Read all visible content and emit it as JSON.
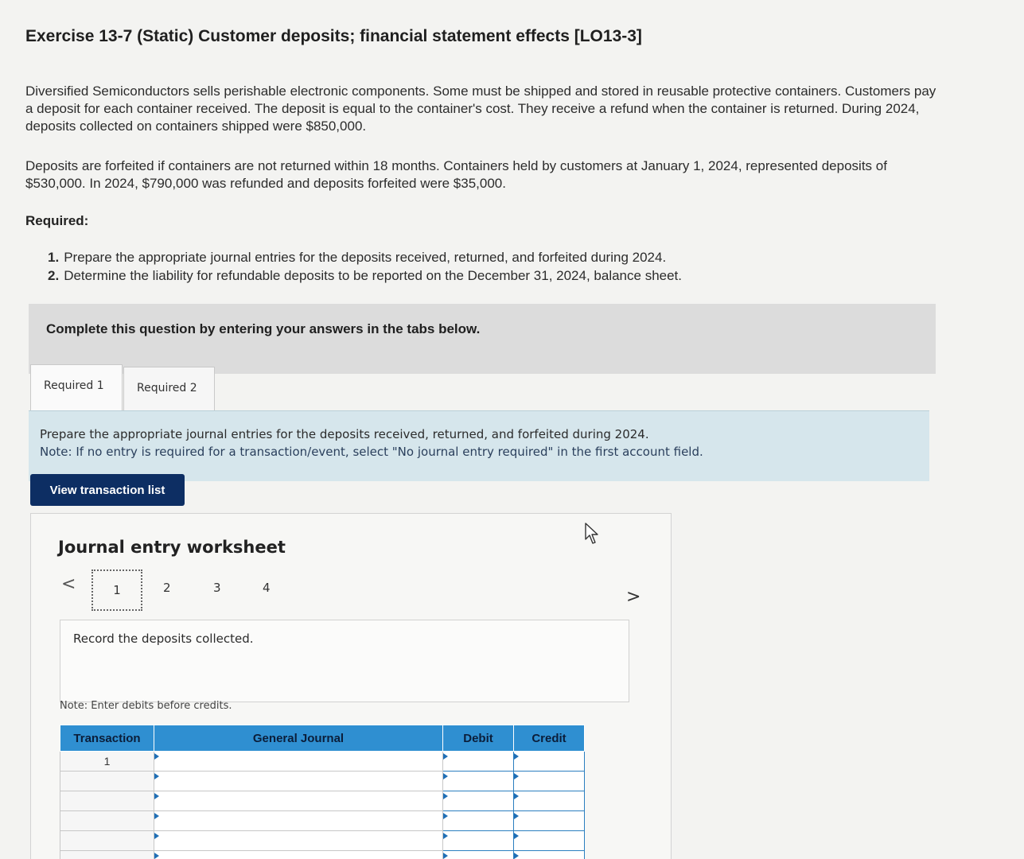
{
  "title": "Exercise 13-7 (Static) Customer deposits; financial statement effects [LO13-3]",
  "paragraph1": "Diversified Semiconductors sells perishable electronic components. Some must be shipped and stored in reusable protective containers. Customers pay a deposit for each container received. The deposit is equal to the container's cost. They receive a refund when the container is returned. During 2024, deposits collected on containers shipped were $850,000.",
  "paragraph2": "Deposits are forfeited if containers are not returned within 18 months. Containers held by customers at January 1, 2024, represented deposits of $530,000. In 2024, $790,000 was refunded and deposits forfeited were $35,000.",
  "required_label": "Required:",
  "requirements": [
    {
      "num": "1.",
      "text": "Prepare the appropriate journal entries for the deposits received, returned, and forfeited during 2024."
    },
    {
      "num": "2.",
      "text": "Determine the liability for refundable deposits to be reported on the December 31, 2024, balance sheet."
    }
  ],
  "complete_prompt": "Complete this question by entering your answers in the tabs below.",
  "tabs": [
    {
      "label": "Required 1"
    },
    {
      "label": "Required 2"
    }
  ],
  "instructions": {
    "main": "Prepare the appropriate journal entries for the deposits received, returned, and forfeited during 2024.",
    "note": "Note: If no entry is required for a transaction/event, select \"No journal entry required\" in the first account field."
  },
  "view_button": "View transaction list",
  "worksheet": {
    "title": "Journal entry worksheet",
    "steps": [
      "1",
      "2",
      "3",
      "4"
    ],
    "active_step": "1",
    "prev_icon": "<",
    "next_icon": ">",
    "record_text": "Record the deposits collected.",
    "enter_note": "Note: Enter debits before credits."
  },
  "table": {
    "headers": {
      "transaction": "Transaction",
      "general_journal": "General Journal",
      "debit": "Debit",
      "credit": "Credit"
    },
    "rows": [
      {
        "transaction": "1",
        "account": "",
        "debit": "",
        "credit": ""
      },
      {
        "transaction": "",
        "account": "",
        "debit": "",
        "credit": ""
      },
      {
        "transaction": "",
        "account": "",
        "debit": "",
        "credit": ""
      },
      {
        "transaction": "",
        "account": "",
        "debit": "",
        "credit": ""
      },
      {
        "transaction": "",
        "account": "",
        "debit": "",
        "credit": ""
      },
      {
        "transaction": "",
        "account": "",
        "debit": "",
        "credit": ""
      }
    ]
  },
  "colors": {
    "button_bg": "#0d2e63",
    "table_header_bg": "#2f8fd1",
    "instruction_bg": "#d6e6ec",
    "complete_bar_bg": "#dcdcdc"
  },
  "icons": {
    "prev": "chevron-left-icon",
    "next": "chevron-right-icon",
    "pointer": "mouse-pointer-icon"
  }
}
